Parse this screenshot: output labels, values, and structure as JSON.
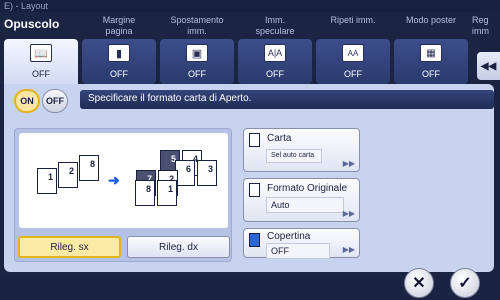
{
  "header": {
    "breadcrumb": "E) - Layout"
  },
  "section_title": "Opuscolo",
  "tabs": [
    {
      "label": "",
      "state": "OFF",
      "icon": "booklet-icon",
      "active": true
    },
    {
      "label": "Margine\npagina",
      "state": "OFF",
      "icon": "page-margin-icon"
    },
    {
      "label": "Spostamento\nimm.",
      "state": "OFF",
      "icon": "image-shift-icon"
    },
    {
      "label": "Imm.\nspeculare",
      "state": "OFF",
      "icon": "mirror-image-icon"
    },
    {
      "label": "Ripeti imm.",
      "state": "OFF",
      "icon": "repeat-image-icon"
    },
    {
      "label": "Modo poster",
      "state": "OFF",
      "icon": "poster-mode-icon"
    },
    {
      "label": "Reg\nimm",
      "state": "OFF",
      "icon": "image-register-icon"
    }
  ],
  "toggle": {
    "on": "ON",
    "off": "OFF",
    "selected": "ON"
  },
  "message": "Specificare il formato carta di Aperto.",
  "diagram": {
    "left_pages": [
      "1",
      "2",
      "8"
    ],
    "right_pages": [
      "5",
      "4",
      "6",
      "3",
      "7",
      "2",
      "8",
      "1"
    ]
  },
  "binding": {
    "left": "Rileg. sx",
    "right": "Rileg. dx",
    "selected": "left"
  },
  "options": {
    "paper": {
      "label": "Carta",
      "value": "Sel auto carta"
    },
    "original_size": {
      "label": "Formato Originale",
      "value": "Auto"
    },
    "cover": {
      "label": "Copertina",
      "value": "OFF"
    }
  },
  "footer": {
    "cancel": "✕",
    "ok": "✓"
  },
  "colors": {
    "accent": "#e3b31a",
    "panel": "#c8d3ef",
    "dark_bg": "#1c2444"
  }
}
